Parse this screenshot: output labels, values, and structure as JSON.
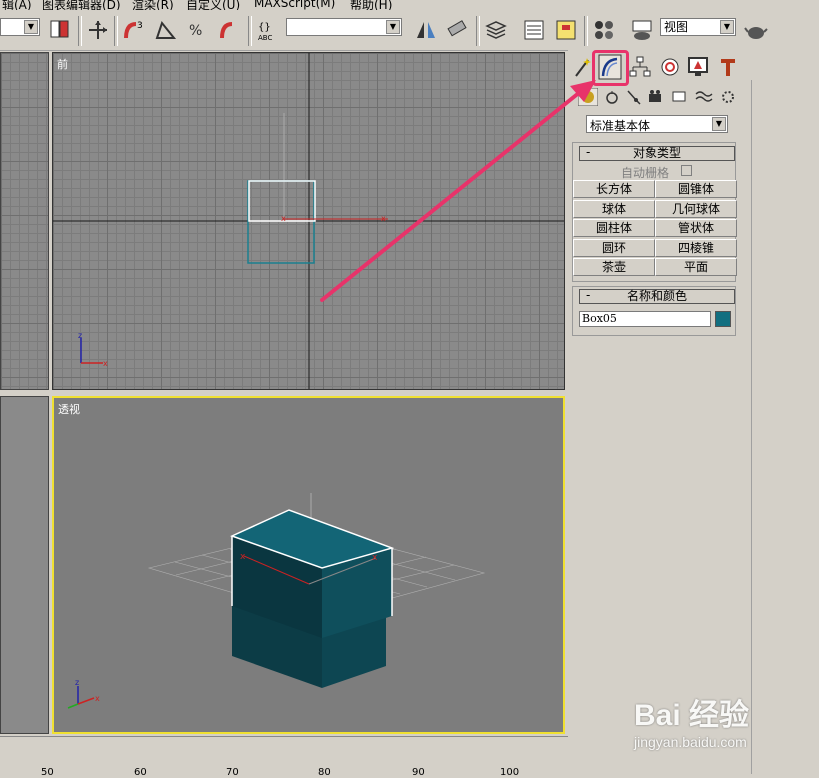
{
  "menu": [
    "辑(A)",
    "图表编辑器(D)",
    "渲染(R)",
    "自定义(U)",
    "MAXScript(M)",
    "帮助(H)"
  ],
  "toolbar": {
    "viewport_select": "视图"
  },
  "viewports": {
    "front_label": "前",
    "perspective_label": "透视"
  },
  "ruler_ticks": [
    "50",
    "60",
    "70",
    "80",
    "90",
    "100"
  ],
  "panel": {
    "category_dropdown": "标准基本体",
    "object_type": {
      "title": "对象类型",
      "minus": "-",
      "autogrid_label": "自动栅格",
      "buttons": [
        "长方体",
        "圆锥体",
        "球体",
        "几何球体",
        "圆柱体",
        "管状体",
        "圆环",
        "四棱锥",
        "茶壶",
        "平面"
      ]
    },
    "name_color": {
      "title": "名称和颜色",
      "minus": "-",
      "name_value": "Box05",
      "color": "#126f80"
    }
  },
  "colors": {
    "highlight": "#e8336a",
    "active_viewport": "#f0e030",
    "box": "#0f4f5c"
  },
  "watermark": {
    "brand": "Bai 经验",
    "url": "jingyan.baidu.com"
  }
}
